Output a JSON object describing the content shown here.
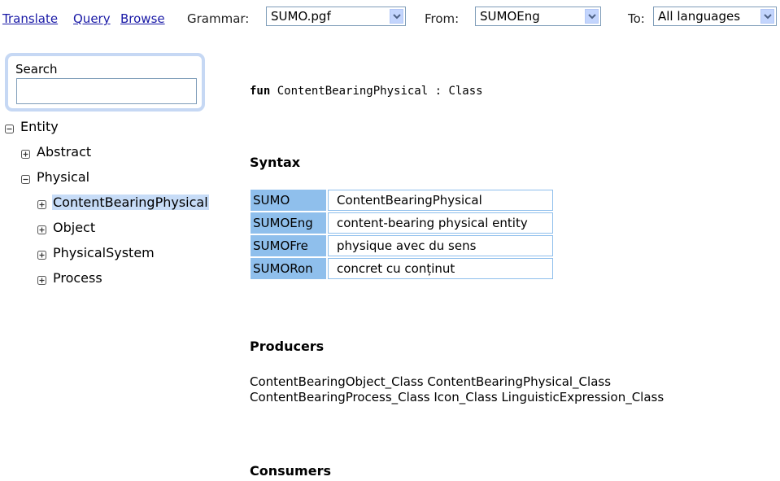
{
  "nav": {
    "links": [
      "Translate",
      "Query",
      "Browse"
    ],
    "grammar_label": "Grammar:",
    "grammar_value": "SUMO.pgf",
    "from_label": "From:",
    "from_value": "SUMOEng",
    "to_label": "To:",
    "to_value": "All languages"
  },
  "search": {
    "label": "Search",
    "value": ""
  },
  "tree": [
    {
      "label": "Entity",
      "toggle": "minus",
      "level": 0,
      "selected": false
    },
    {
      "label": "Abstract",
      "toggle": "plus",
      "level": 1,
      "selected": false
    },
    {
      "label": "Physical",
      "toggle": "minus",
      "level": 1,
      "selected": false
    },
    {
      "label": "ContentBearingPhysical",
      "toggle": "plus",
      "level": 2,
      "selected": true
    },
    {
      "label": "Object",
      "toggle": "plus",
      "level": 2,
      "selected": false
    },
    {
      "label": "PhysicalSystem",
      "toggle": "plus",
      "level": 2,
      "selected": false
    },
    {
      "label": "Process",
      "toggle": "plus",
      "level": 2,
      "selected": false
    }
  ],
  "main": {
    "fun_keyword": "fun",
    "fun_rest": " ContentBearingPhysical : Class",
    "syntax_heading": "Syntax",
    "syntax_rows": [
      {
        "lang": "SUMO",
        "lin": "ContentBearingPhysical"
      },
      {
        "lang": "SUMOEng",
        "lin": "content-bearing physical entity"
      },
      {
        "lang": "SUMOFre",
        "lin": "physique avec du sens"
      },
      {
        "lang": "SUMORon",
        "lin": "concret cu conținut"
      }
    ],
    "producers_heading": "Producers",
    "producers_line1": "ContentBearingObject_Class ContentBearingPhysical_Class",
    "producers_line2": "ContentBearingProcess_Class Icon_Class LinguisticExpression_Class",
    "consumers_heading": "Consumers"
  },
  "colors": {
    "link": "#1a1aa6",
    "table_header": "#8fbfec",
    "selection": "#c7dcf7",
    "search_border": "#c6d8f4"
  }
}
